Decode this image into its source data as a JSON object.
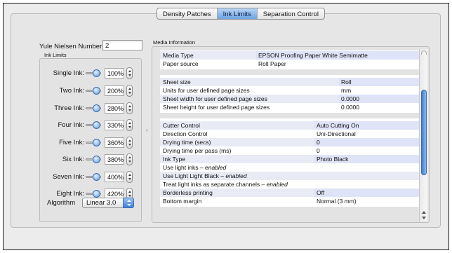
{
  "tabs": [
    {
      "label": "Density Patches",
      "active": false
    },
    {
      "label": "Ink Limits",
      "active": true
    },
    {
      "label": "Separation Control",
      "active": false
    }
  ],
  "yule": {
    "label": "Yule Nielsen Number:",
    "value": "2"
  },
  "ink_limits": {
    "title": "Ink Limits",
    "rows": [
      {
        "label": "Single Ink:",
        "value": "100%"
      },
      {
        "label": "Two Ink:",
        "value": "200%"
      },
      {
        "label": "Three Ink:",
        "value": "280%"
      },
      {
        "label": "Four Ink:",
        "value": "330%"
      },
      {
        "label": "Five Ink:",
        "value": "360%"
      },
      {
        "label": "Six Ink:",
        "value": "380%"
      },
      {
        "label": "Seven Ink:",
        "value": "400%"
      },
      {
        "label": "Eight Ink:",
        "value": "420%"
      }
    ],
    "algorithm_label": "Algorithm",
    "algorithm_value": "Linear 3.0"
  },
  "media": {
    "title": "Media Information",
    "sections": [
      [
        {
          "k": "Media Type",
          "v": "EPSON Proofing Paper White Semimatte",
          "alt": true
        },
        {
          "k": "Paper source",
          "v": "Roll Paper",
          "alt": false
        }
      ],
      [
        {
          "k": "Sheet size",
          "v": "Roll",
          "alt": true
        },
        {
          "k": "Units for user defined page sizes",
          "v": "mm",
          "alt": false
        },
        {
          "k": "Sheet width for user defined page sizes",
          "v": "0.0000",
          "alt": true
        },
        {
          "k": "Sheet height for user defined page sizes",
          "v": "0.0000",
          "alt": false
        }
      ],
      [
        {
          "k": "Cutter Control",
          "v": "Auto Cutting On",
          "alt": true
        },
        {
          "k": "Direction Control",
          "v": "Uni-Directional",
          "alt": false
        },
        {
          "k": "Drying time (secs)",
          "v": "0",
          "alt": true
        },
        {
          "k": "Drying time per pass (ms)",
          "v": "0",
          "alt": false
        },
        {
          "k": "Ink Type",
          "v": "Photo Black",
          "alt": true
        },
        {
          "k": "Use light inks",
          "em": "enabled",
          "alt": false
        },
        {
          "k": "Use Light Light Black",
          "em": "enabled",
          "alt": true
        },
        {
          "k": "Treat light inks as separate channels",
          "em": "enabled",
          "alt": false
        },
        {
          "k": "Borderless printing",
          "v": "Off",
          "alt": true
        },
        {
          "k": "Bottom margin",
          "v": "Normal (3 mm)",
          "alt": false
        }
      ]
    ]
  },
  "colors": {
    "accent": "#3d7fd6",
    "row_alt": "#e8eaf5"
  }
}
